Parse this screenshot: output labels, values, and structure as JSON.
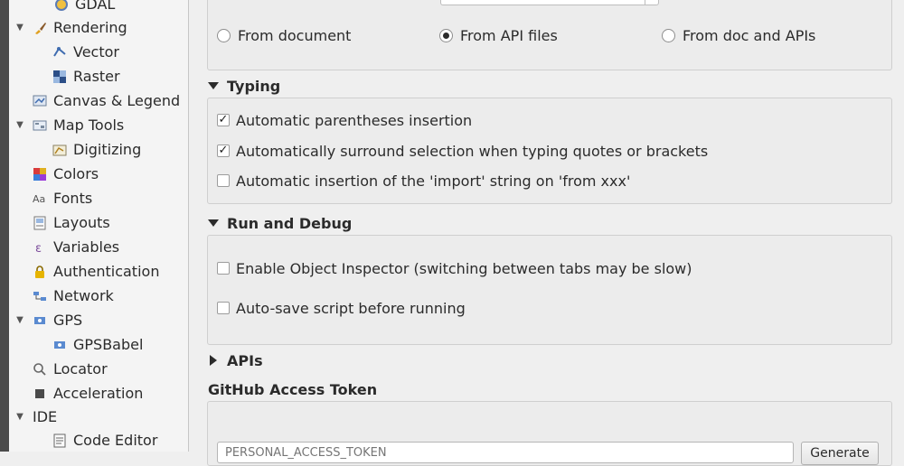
{
  "sidebar": {
    "items": [
      {
        "label": "GDAL",
        "icon": "gdal-icon"
      },
      {
        "label": "Rendering",
        "icon": "paintbrush-icon"
      },
      {
        "label": "Vector",
        "icon": "vector-icon"
      },
      {
        "label": "Raster",
        "icon": "raster-icon"
      },
      {
        "label": "Canvas & Legend",
        "icon": "canvas-legend-icon"
      },
      {
        "label": "Map Tools",
        "icon": "map-tools-icon"
      },
      {
        "label": "Digitizing",
        "icon": "digitizing-icon"
      },
      {
        "label": "Colors",
        "icon": "colors-icon"
      },
      {
        "label": "Fonts",
        "icon": "fonts-icon"
      },
      {
        "label": "Layouts",
        "icon": "layouts-icon"
      },
      {
        "label": "Variables",
        "icon": "variables-icon"
      },
      {
        "label": "Authentication",
        "icon": "lock-icon"
      },
      {
        "label": "Network",
        "icon": "network-icon"
      },
      {
        "label": "GPS",
        "icon": "gps-icon"
      },
      {
        "label": "GPSBabel",
        "icon": "gpsbabel-icon"
      },
      {
        "label": "Locator",
        "icon": "search-icon"
      },
      {
        "label": "Acceleration",
        "icon": "acceleration-icon"
      },
      {
        "label": "IDE",
        "icon": ""
      },
      {
        "label": "Code Editor",
        "icon": "code-editor-icon"
      }
    ]
  },
  "autocompletion": {
    "radios": [
      {
        "label": "From document",
        "checked": false
      },
      {
        "label": "From API files",
        "checked": true
      },
      {
        "label": "From doc and APIs",
        "checked": false
      }
    ]
  },
  "typing": {
    "title": "Typing",
    "options": [
      {
        "label": "Automatic parentheses insertion",
        "checked": true
      },
      {
        "label": "Automatically surround selection when typing quotes or brackets",
        "checked": true
      },
      {
        "label": "Automatic insertion of the 'import' string on 'from xxx'",
        "checked": false
      }
    ]
  },
  "run_debug": {
    "title": "Run and Debug",
    "options": [
      {
        "label": "Enable Object Inspector (switching between tabs may be slow)",
        "checked": false
      },
      {
        "label": "Auto-save script before running",
        "checked": false
      }
    ]
  },
  "apis": {
    "title": "APIs"
  },
  "github": {
    "title": "GitHub Access Token",
    "placeholder": "PERSONAL_ACCESS_TOKEN",
    "generate_label": "Generate"
  },
  "colors": {
    "check": "#1a1a1a",
    "panel_bg": "#efefef",
    "group_bg": "#ececec",
    "lock": "#e6b400"
  }
}
